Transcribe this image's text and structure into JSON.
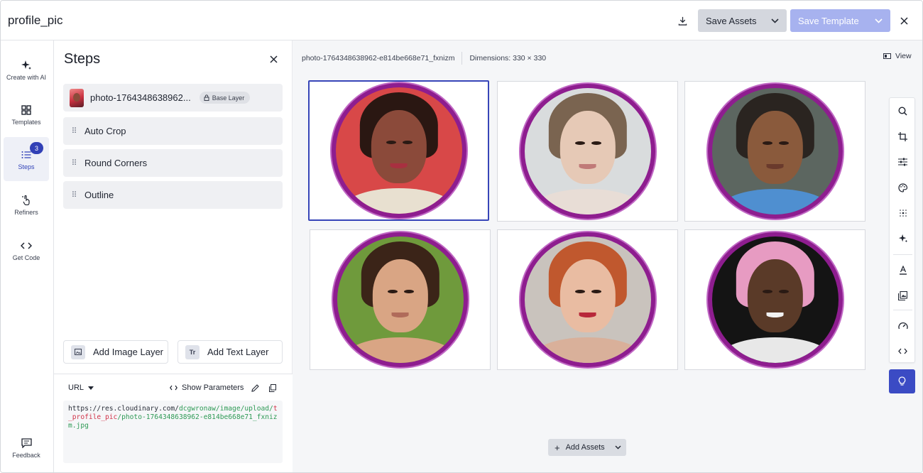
{
  "header": {
    "title": "profile_pic",
    "save_assets_label": "Save Assets",
    "save_template_label": "Save Template"
  },
  "nav": {
    "items": [
      {
        "label": "Create with AI",
        "icon": "sparkle-icon"
      },
      {
        "label": "Templates",
        "icon": "grid-icon"
      },
      {
        "label": "Steps",
        "icon": "list-icon",
        "badge": "3"
      },
      {
        "label": "Refiners",
        "icon": "pointer-icon"
      },
      {
        "label": "Get Code",
        "icon": "code-icon"
      }
    ],
    "feedback_label": "Feedback"
  },
  "steps_panel": {
    "title": "Steps",
    "base_step": {
      "name": "photo-1764348638962...",
      "badge": "Base Layer"
    },
    "steps": [
      "Auto Crop",
      "Round Corners",
      "Outline"
    ],
    "add_image_label": "Add Image Layer",
    "add_text_label": "Add Text Layer",
    "text_icon_glyph": "Tr",
    "url": {
      "mode": "URL",
      "show_params_label": "Show Parameters",
      "base": "https://res.cloudinary.com/",
      "cloud": "dcgwronaw/image/",
      "upload": "upload/",
      "transformation": "t_profile_pic",
      "slash": "/",
      "file": "photo-1764348638962-e814be668e71_fxnizm.jpg"
    }
  },
  "main": {
    "filename": "photo-1764348638962-e814be668e71_fxnizm",
    "dimensions": "Dimensions: 330 × 330",
    "view_label": "View",
    "add_assets_label": "Add Assets",
    "assets": [
      {
        "skin": "#8b4a3a",
        "hair": "#2a1712",
        "bg": "#d84848",
        "shirt": "#e8e0d0",
        "mouth": "#a83040"
      },
      {
        "skin": "#e6c9b6",
        "hair": "#7a6450",
        "bg": "#d9dcdd",
        "shirt": "#e8ddd6",
        "mouth": "#c07a78"
      },
      {
        "skin": "#8a5a3c",
        "hair": "#2a2420",
        "bg": "#5c6660",
        "shirt": "#4f8fd0",
        "mouth": "#6a3a2c"
      },
      {
        "skin": "#d9a584",
        "hair": "#3b2418",
        "bg": "#6f9a3c",
        "shirt": "#d9a584",
        "mouth": "#b06b5a"
      },
      {
        "skin": "#e9bca2",
        "hair": "#c0582e",
        "bg": "#c9c3bd",
        "shirt": "#d9b09a",
        "mouth": "#b8283a"
      },
      {
        "skin": "#5a3a28",
        "hair": "#e79bc2",
        "bg": "#141414",
        "shirt": "#e8e8e8",
        "mouth": "#f2f2f2"
      }
    ]
  },
  "colors": {
    "accent": "#3b4bc4",
    "outline": "#8e1d8f"
  }
}
